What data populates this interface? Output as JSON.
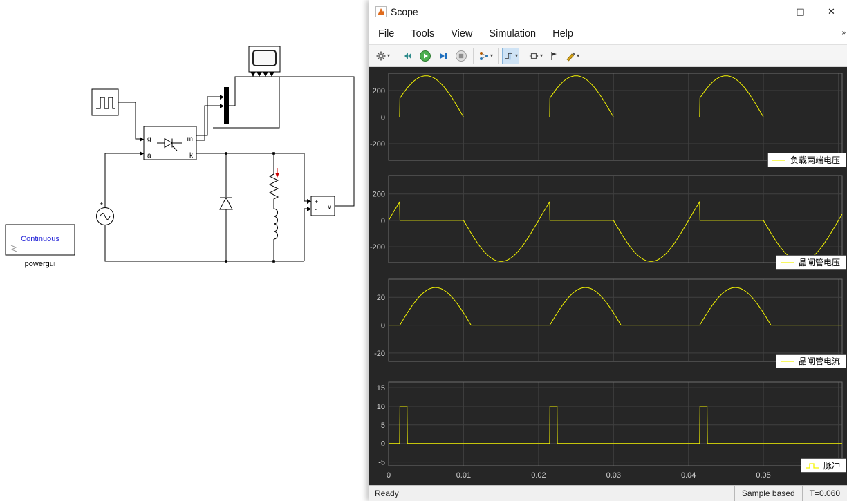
{
  "window": {
    "title": "Scope",
    "minimize_glyph": "–",
    "maximize_glyph": "□",
    "close_glyph": "✕"
  },
  "menu": {
    "items": [
      "File",
      "Tools",
      "View",
      "Simulation",
      "Help"
    ]
  },
  "ui_glyphs": {
    "dropdown": "▾",
    "overflow": "»"
  },
  "toolbar": {
    "icons": [
      "settings-gear",
      "step-back",
      "run",
      "step-forward",
      "stop",
      "signal-selector",
      "trigger",
      "axes-scale",
      "cursor-measurements",
      "highlight"
    ]
  },
  "statusbar": {
    "left": "Ready",
    "sample_mode": "Sample based",
    "time": "T=0.060"
  },
  "diagram": {
    "thyristor": {
      "g": "g",
      "m": "m",
      "a": "a",
      "k": "k"
    },
    "vmeter": {
      "plus": "+",
      "minus": "-",
      "label": "v"
    },
    "source": {
      "plus": "+"
    },
    "powergui": {
      "mode": "Continuous",
      "name": "powergui"
    }
  },
  "colors": {
    "canvas_bg": "#262626",
    "axes_bg": "#262626",
    "grid": "#404040",
    "axes_border": "#6e6e6e",
    "tick_label": "#cfcfcf",
    "trace": "#f5f500",
    "legend_bg": "#ffffff"
  },
  "chart_data": [
    {
      "type": "line",
      "legend": "负载两端电压",
      "legend_glyph": "line",
      "trace_color": "#f5f500",
      "x_range": [
        0,
        0.0605
      ],
      "ylim": [
        -325,
        330
      ],
      "yticks": [
        -200,
        0,
        200
      ],
      "xticks": [
        0,
        0.01,
        0.02,
        0.03,
        0.04,
        0.05,
        0.06
      ],
      "xtick_labels": [
        "0",
        "0.01",
        "0.02",
        "0.03",
        "0.04",
        "0.05",
        ""
      ],
      "grid": true,
      "legend_position": "bottom-right",
      "waveform": {
        "kind": "gated_sine",
        "amplitude": 311,
        "period": 0.02,
        "fire_time": 0.0015
      }
    },
    {
      "type": "line",
      "legend": "晶闸管电压",
      "legend_glyph": "line",
      "trace_color": "#f5f500",
      "x_range": [
        0,
        0.0605
      ],
      "ylim": [
        -320,
        340
      ],
      "yticks": [
        -200,
        0,
        200
      ],
      "xticks": [
        0,
        0.01,
        0.02,
        0.03,
        0.04,
        0.05,
        0.06
      ],
      "xtick_labels": [
        "0",
        "0.01",
        "0.02",
        "0.03",
        "0.04",
        "0.05",
        ""
      ],
      "grid": true,
      "legend_position": "bottom-right",
      "waveform": {
        "kind": "thyristor_voltage",
        "amplitude": 311,
        "period": 0.02,
        "fire_time": 0.0015
      }
    },
    {
      "type": "line",
      "legend": "晶闸管电流",
      "legend_glyph": "line",
      "trace_color": "#f5f500",
      "x_range": [
        0,
        0.0605
      ],
      "ylim": [
        -26,
        33
      ],
      "yticks": [
        -20,
        0,
        20
      ],
      "xticks": [
        0,
        0.01,
        0.02,
        0.03,
        0.04,
        0.05,
        0.06
      ],
      "xtick_labels": [
        "0",
        "0.01",
        "0.02",
        "0.03",
        "0.04",
        "0.05",
        ""
      ],
      "grid": true,
      "legend_position": "bottom-right",
      "waveform": {
        "kind": "half_sine_pulse",
        "peak": 27,
        "period": 0.02,
        "start": 0.0015,
        "end": 0.011
      }
    },
    {
      "type": "line",
      "legend": "脉冲",
      "legend_glyph": "step",
      "trace_color": "#f5f500",
      "x_range": [
        0,
        0.0605
      ],
      "ylim": [
        -6,
        16.5
      ],
      "yticks": [
        -5,
        0,
        5,
        10,
        15
      ],
      "xticks": [
        0,
        0.01,
        0.02,
        0.03,
        0.04,
        0.05,
        0.06
      ],
      "xtick_labels": [
        "0",
        "0.01",
        "0.02",
        "0.03",
        "0.04",
        "0.05",
        ""
      ],
      "grid": true,
      "legend_position": "bottom-right",
      "waveform": {
        "kind": "pulse_train",
        "high": 10,
        "low": 0,
        "period": 0.02,
        "start": 0.0015,
        "width": 0.001
      }
    }
  ]
}
